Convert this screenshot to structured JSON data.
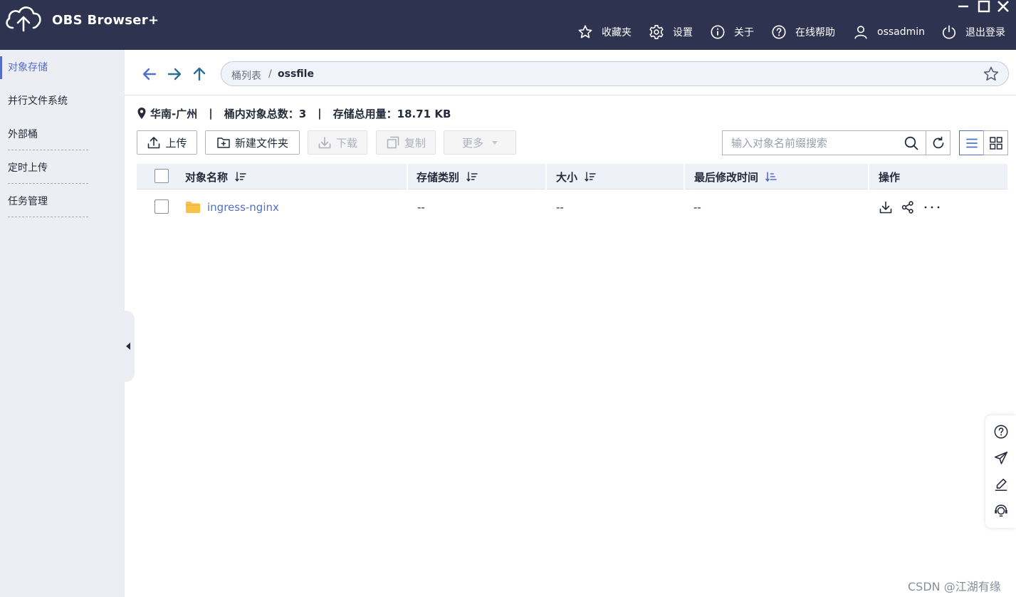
{
  "app": {
    "title": "OBS Browser+"
  },
  "topnav": {
    "favorites": "收藏夹",
    "settings": "设置",
    "about": "关于",
    "online_help": "在线帮助",
    "user": "ossadmin",
    "logout": "退出登录"
  },
  "sidebar": {
    "items": [
      {
        "label": "对象存储",
        "active": true
      },
      {
        "label": "并行文件系统",
        "active": false
      },
      {
        "label": "外部桶",
        "active": false
      },
      {
        "label": "定时上传",
        "active": false
      },
      {
        "label": "任务管理",
        "active": false
      }
    ]
  },
  "breadcrumb": {
    "root": "桶列表",
    "separator": "/",
    "current": "ossfile"
  },
  "bucket_info": {
    "region": "华南-广州",
    "separator": "|",
    "object_count": "桶内对象总数：3",
    "storage_used": "存储总用量：18.71 KB"
  },
  "actions": {
    "upload": "上传",
    "new_folder": "新建文件夹",
    "download": "下载",
    "copy": "复制",
    "more": "更多"
  },
  "search": {
    "placeholder": "输入对象名前缀搜索"
  },
  "table": {
    "columns": [
      "对象名称",
      "存储类别",
      "大小",
      "最后修改时间",
      "操作"
    ],
    "rows": [
      {
        "name": "ingress-nginx",
        "storage_class": "--",
        "size": "--",
        "modified": "--"
      }
    ]
  },
  "watermark": "CSDN @江湖有缘",
  "colors": {
    "titlebar": "#2e344f",
    "accent": "#526ecc",
    "sidebar": "#edeef3",
    "folder": "#f7c24a"
  }
}
